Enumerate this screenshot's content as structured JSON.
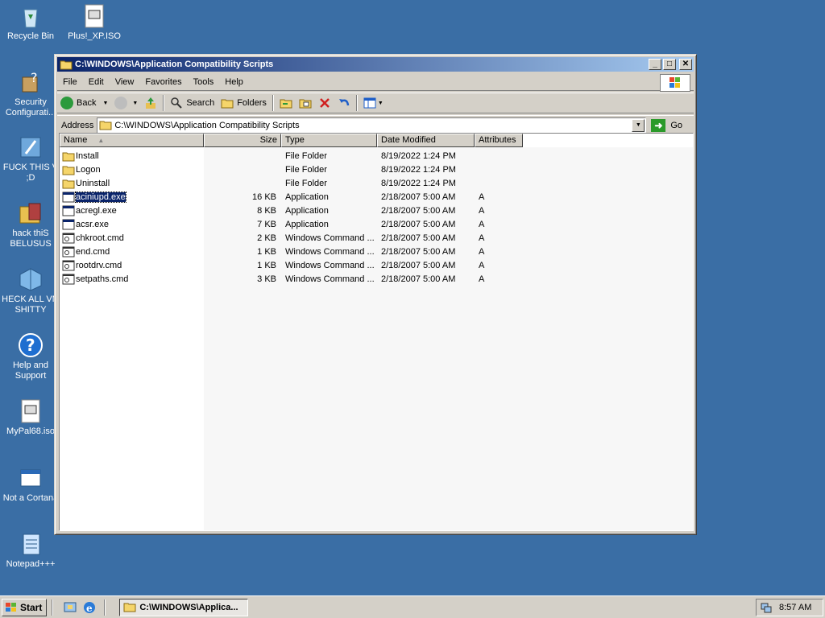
{
  "desktop": {
    "icons": [
      {
        "label": "Recycle Bin"
      },
      {
        "label": "Plus!_XP.ISO"
      },
      {
        "label": "Security Configurati..."
      },
      {
        "label": "FUCK THIS V ;D"
      },
      {
        "label": "hack thiS BELUSUS"
      },
      {
        "label": "HECK ALL VM SHITTY"
      },
      {
        "label": "Help and Support"
      },
      {
        "label": "MyPal68.iso"
      },
      {
        "label": "Not a Cortana"
      },
      {
        "label": "Notepad+++"
      }
    ]
  },
  "window": {
    "title": "C:\\WINDOWS\\Application Compatibility Scripts",
    "menu": [
      {
        "label": "File"
      },
      {
        "label": "Edit"
      },
      {
        "label": "View"
      },
      {
        "label": "Favorites"
      },
      {
        "label": "Tools"
      },
      {
        "label": "Help"
      }
    ],
    "toolbar": {
      "back": "Back",
      "search": "Search",
      "folders": "Folders"
    },
    "address": {
      "label": "Address",
      "value": "C:\\WINDOWS\\Application Compatibility Scripts",
      "go": "Go"
    },
    "columns": [
      "Name",
      "Size",
      "Type",
      "Date Modified",
      "Attributes"
    ],
    "files": [
      {
        "name": "Install",
        "size": "",
        "type": "File Folder",
        "date": "8/19/2022 1:24 PM",
        "attr": "",
        "kind": "folder"
      },
      {
        "name": "Logon",
        "size": "",
        "type": "File Folder",
        "date": "8/19/2022 1:24 PM",
        "attr": "",
        "kind": "folder"
      },
      {
        "name": "Uninstall",
        "size": "",
        "type": "File Folder",
        "date": "8/19/2022 1:24 PM",
        "attr": "",
        "kind": "folder"
      },
      {
        "name": "aciniupd.exe",
        "size": "16 KB",
        "type": "Application",
        "date": "2/18/2007 5:00 AM",
        "attr": "A",
        "kind": "app",
        "selected": true
      },
      {
        "name": "acregl.exe",
        "size": "8 KB",
        "type": "Application",
        "date": "2/18/2007 5:00 AM",
        "attr": "A",
        "kind": "app"
      },
      {
        "name": "acsr.exe",
        "size": "7 KB",
        "type": "Application",
        "date": "2/18/2007 5:00 AM",
        "attr": "A",
        "kind": "app"
      },
      {
        "name": "chkroot.cmd",
        "size": "2 KB",
        "type": "Windows Command ...",
        "date": "2/18/2007 5:00 AM",
        "attr": "A",
        "kind": "cmd"
      },
      {
        "name": "end.cmd",
        "size": "1 KB",
        "type": "Windows Command ...",
        "date": "2/18/2007 5:00 AM",
        "attr": "A",
        "kind": "cmd"
      },
      {
        "name": "rootdrv.cmd",
        "size": "1 KB",
        "type": "Windows Command ...",
        "date": "2/18/2007 5:00 AM",
        "attr": "A",
        "kind": "cmd"
      },
      {
        "name": "setpaths.cmd",
        "size": "3 KB",
        "type": "Windows Command ...",
        "date": "2/18/2007 5:00 AM",
        "attr": "A",
        "kind": "cmd"
      }
    ]
  },
  "taskbar": {
    "start": "Start",
    "task": "C:\\WINDOWS\\Applica...",
    "clock": "8:57 AM"
  },
  "colors": {
    "desktop": "#3a6ea5",
    "titlebar_start": "#0a246a",
    "titlebar_end": "#a6caf0",
    "selection": "#0a246a"
  }
}
